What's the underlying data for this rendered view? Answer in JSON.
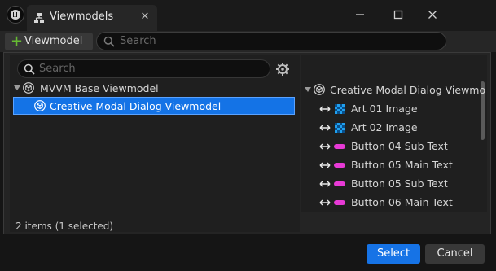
{
  "window": {
    "tab_title": "Viewmodels",
    "tab_close": "✕"
  },
  "toolbar": {
    "add_label": "Viewmodel",
    "add_icon": "plus-icon",
    "search_placeholder": "Search"
  },
  "left": {
    "search_placeholder": "Search",
    "tree": [
      {
        "label": "MVVM Base Viewmodel",
        "expanded": true,
        "icon": "cube-icon"
      },
      {
        "label": "Creative Modal Dialog Viewmodel",
        "selected": true,
        "icon": "cube-icon"
      }
    ],
    "status": "2 items (1 selected)"
  },
  "right": {
    "root": "Creative Modal Dialog Viewmo",
    "properties": [
      {
        "label": "Art 01 Image",
        "type": "image"
      },
      {
        "label": "Art 02 Image",
        "type": "image"
      },
      {
        "label": "Button 04 Sub Text",
        "type": "text"
      },
      {
        "label": "Button 05 Main Text",
        "type": "text"
      },
      {
        "label": "Button 05 Sub Text",
        "type": "text"
      },
      {
        "label": "Button 06 Main Text",
        "type": "text"
      }
    ]
  },
  "footer": {
    "select_label": "Select",
    "cancel_label": "Cancel"
  },
  "colors": {
    "accent": "#1473e6",
    "text_property": "#e83ad6",
    "image_property": "#1fa0f0",
    "add_plus": "#66bb33"
  }
}
